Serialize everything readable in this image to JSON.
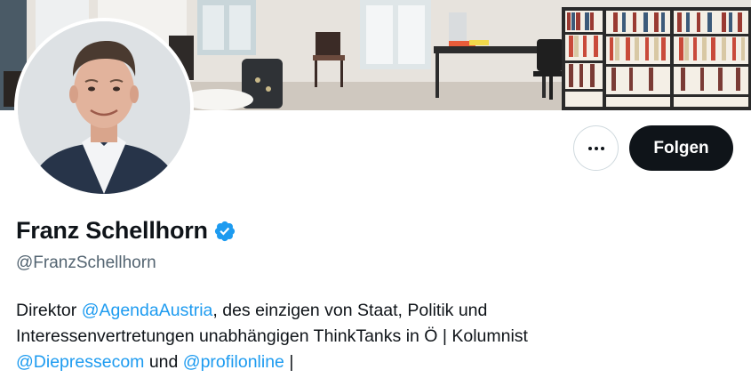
{
  "profile": {
    "display_name": "Franz Schellhorn",
    "handle": "@FranzSchellhorn",
    "verified_icon": "verified-badge-icon",
    "bio": {
      "line1_prefix": "Direktor ",
      "mention1": "@AgendaAustria",
      "line1_suffix": ", des einzigen von Staat, Politik und",
      "line2": "Interessenvertretungen unabhängigen ThinkTanks in Ö | Kolumnist",
      "mention2": "@Diepressecom",
      "connector": " und ",
      "mention3": "@profilonline",
      "trailing": " |"
    }
  },
  "actions": {
    "more_icon": "more-horizontal-icon",
    "follow_label": "Folgen"
  },
  "colors": {
    "accent": "#1d9bf0",
    "text_primary": "#0f1419",
    "text_secondary": "#536471",
    "button_dark": "#0f1419"
  }
}
